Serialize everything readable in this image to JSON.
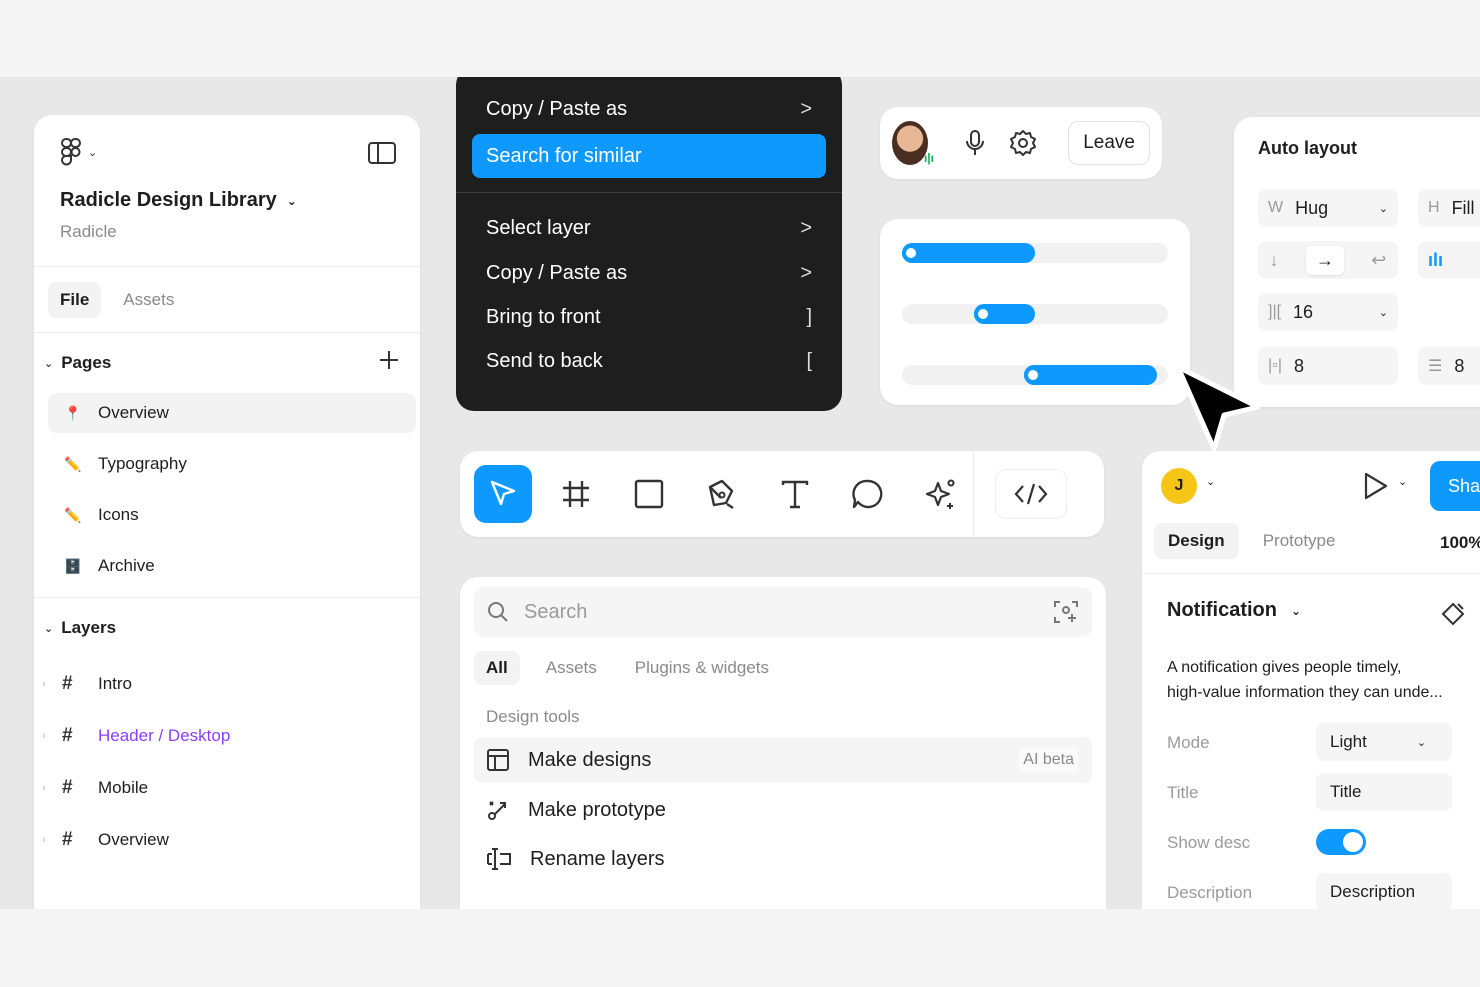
{
  "left_panel": {
    "project_title": "Radicle Design Library",
    "project_sub": "Radicle",
    "tabs": [
      {
        "label": "File"
      },
      {
        "label": "Assets"
      }
    ],
    "pages_header": "Pages",
    "pages": [
      {
        "label": "Overview",
        "icon": "📍"
      },
      {
        "label": "Typography",
        "icon": "✏️"
      },
      {
        "label": "Icons",
        "icon": "✏️"
      },
      {
        "label": "Archive",
        "icon": "🗄️"
      }
    ],
    "layers_header": "Layers",
    "layers": [
      {
        "label": "Intro"
      },
      {
        "label": "Header / Desktop"
      },
      {
        "label": "Mobile"
      },
      {
        "label": "Overview"
      }
    ]
  },
  "context_menu": {
    "items": [
      {
        "label": "Copy / Paste as",
        "shortcut": ">"
      },
      {
        "label": "Search for similar",
        "shortcut": ""
      },
      {
        "label": "Select layer",
        "shortcut": ">"
      },
      {
        "label": "Copy / Paste as",
        "shortcut": ">"
      },
      {
        "label": "Bring to front",
        "shortcut": "]"
      },
      {
        "label": "Send to back",
        "shortcut": "["
      }
    ]
  },
  "call": {
    "leave_label": "Leave"
  },
  "sliders": [
    {
      "from": 0.0,
      "to": 0.5
    },
    {
      "from": 0.27,
      "to": 0.5
    },
    {
      "from": 0.46,
      "to": 0.96
    }
  ],
  "auto_layout": {
    "title": "Auto layout",
    "width_label": "W",
    "width_value": "Hug",
    "height_label": "H",
    "height_value": "Fill",
    "gap_value": "16",
    "padding_h": "8",
    "padding_v": "8"
  },
  "actions": {
    "search_placeholder": "Search",
    "tabs": [
      {
        "label": "All"
      },
      {
        "label": "Assets"
      },
      {
        "label": "Plugins & widgets"
      }
    ],
    "section": "Design tools",
    "items": [
      {
        "label": "Make designs",
        "badge": "AI beta"
      },
      {
        "label": "Make prototype",
        "badge": ""
      },
      {
        "label": "Rename layers",
        "badge": ""
      }
    ]
  },
  "design_panel": {
    "avatar_initial": "J",
    "share_label": "Share",
    "tabs": [
      {
        "label": "Design"
      },
      {
        "label": "Prototype"
      }
    ],
    "zoom": "100%",
    "component_title": "Notification",
    "component_desc_1": "A notification gives people timely,",
    "component_desc_2": "high-value information they can unde...",
    "props": {
      "mode_label": "Mode",
      "mode_value": "Light",
      "title_label": "Title",
      "title_value": "Title",
      "showdesc_label": "Show desc",
      "description_label": "Description",
      "description_value": "Description"
    }
  },
  "colors": {
    "accent": "#0d99ff",
    "dark_menu": "#1e1e1e",
    "purple": "#8a3ffc"
  }
}
